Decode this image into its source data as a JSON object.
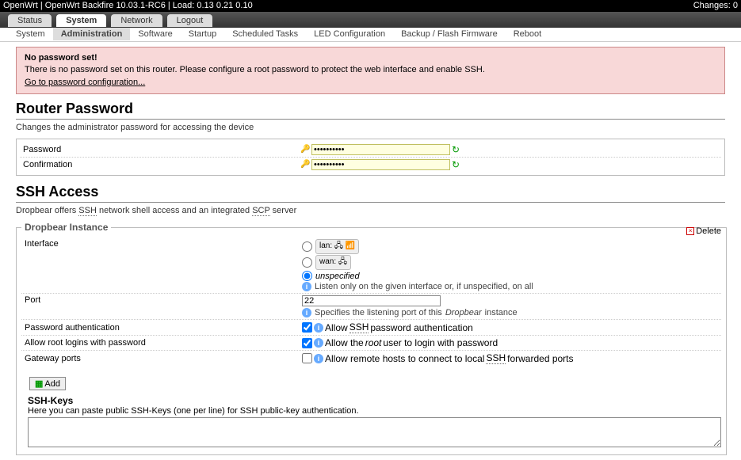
{
  "topbar": {
    "left": "OpenWrt | OpenWrt Backfire 10.03.1-RC6 | Load: 0.13 0.21 0.10",
    "right": "Changes: 0"
  },
  "nav": {
    "items": [
      "Status",
      "System",
      "Network",
      "Logout"
    ],
    "active_index": 1
  },
  "subnav": {
    "items": [
      "System",
      "Administration",
      "Software",
      "Startup",
      "Scheduled Tasks",
      "LED Configuration",
      "Backup / Flash Firmware",
      "Reboot"
    ],
    "active_index": 1
  },
  "warn": {
    "title": "No password set!",
    "body": "There is no password set on this router. Please configure a root password to protect the web interface and enable SSH.",
    "link": "Go to password configuration..."
  },
  "routerpw": {
    "heading": "Router Password",
    "desc": "Changes the administrator password for accessing the device",
    "pwd_label": "Password",
    "conf_label": "Confirmation",
    "pwd_value": "••••••••••",
    "conf_value": "••••••••••"
  },
  "ssh": {
    "heading": "SSH Access",
    "desc_pre": "Dropbear offers ",
    "abbr1": "SSH",
    "desc_mid": " network shell access and an integrated ",
    "abbr2": "SCP",
    "desc_post": " server",
    "legend": "Dropbear Instance",
    "delete_label": "Delete",
    "iface": {
      "label": "Interface",
      "lan": "lan:",
      "wan": "wan:",
      "unspec": "unspecified",
      "tip": "Listen only on the given interface or, if unspecified, on all"
    },
    "port": {
      "label": "Port",
      "value": "22",
      "tip_pre": "Specifies the listening port of this ",
      "tip_em": "Dropbear",
      "tip_post": " instance"
    },
    "pauth": {
      "label": "Password authentication",
      "tip_pre": "Allow ",
      "abbr": "SSH",
      "tip_post": " password authentication"
    },
    "rootlogin": {
      "label": "Allow root logins with password",
      "tip_pre": "Allow the ",
      "em": "root",
      "tip_post": " user to login with password"
    },
    "gwports": {
      "label": "Gateway ports",
      "tip_pre": "Allow remote hosts to connect to local ",
      "abbr": "SSH",
      "tip_post": " forwarded ports"
    },
    "add_label": "Add",
    "keys": {
      "title": "SSH-Keys",
      "desc": "Here you can paste public SSH-Keys (one per line) for SSH public-key authentication."
    }
  }
}
